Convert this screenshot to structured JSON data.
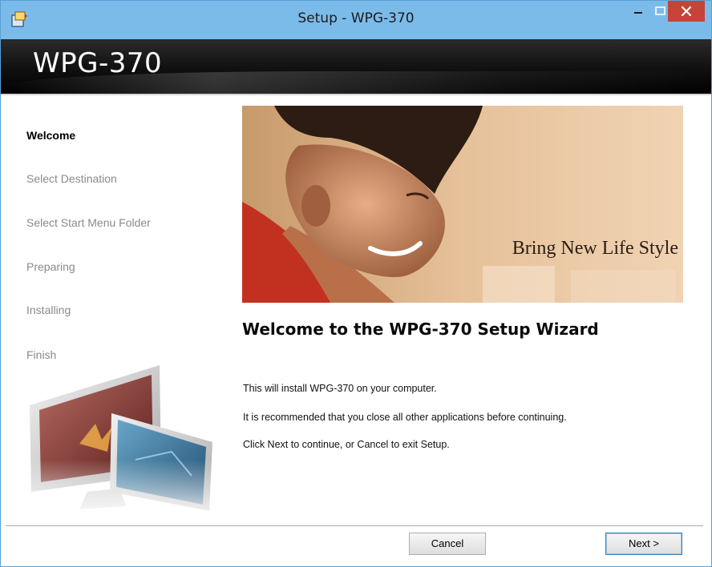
{
  "window": {
    "title": "Setup - WPG-370",
    "controls": {
      "minimize_icon": "minimize-icon",
      "maximize_icon": "maximize-icon",
      "close_icon": "close-icon"
    }
  },
  "header": {
    "title": "WPG-370"
  },
  "sidebar": {
    "steps": [
      {
        "label": "Welcome",
        "active": true
      },
      {
        "label": "Select Destination",
        "active": false
      },
      {
        "label": "Select Start Menu Folder",
        "active": false
      },
      {
        "label": "Preparing",
        "active": false
      },
      {
        "label": "Installing",
        "active": false
      },
      {
        "label": "Finish",
        "active": false
      }
    ]
  },
  "banner": {
    "caption": "Bring New Life Style"
  },
  "main": {
    "heading": "Welcome to the WPG-370 Setup Wizard",
    "paragraphs": [
      "This will install WPG-370 on your computer.",
      "It is recommended that you close all other applications before continuing.",
      "Click Next to continue, or Cancel to exit Setup."
    ]
  },
  "footer": {
    "cancel_label": "Cancel",
    "next_label": "Next >"
  },
  "colors": {
    "titlebar": "#7bbbea",
    "close_button": "#c64339",
    "header": "#000000"
  }
}
